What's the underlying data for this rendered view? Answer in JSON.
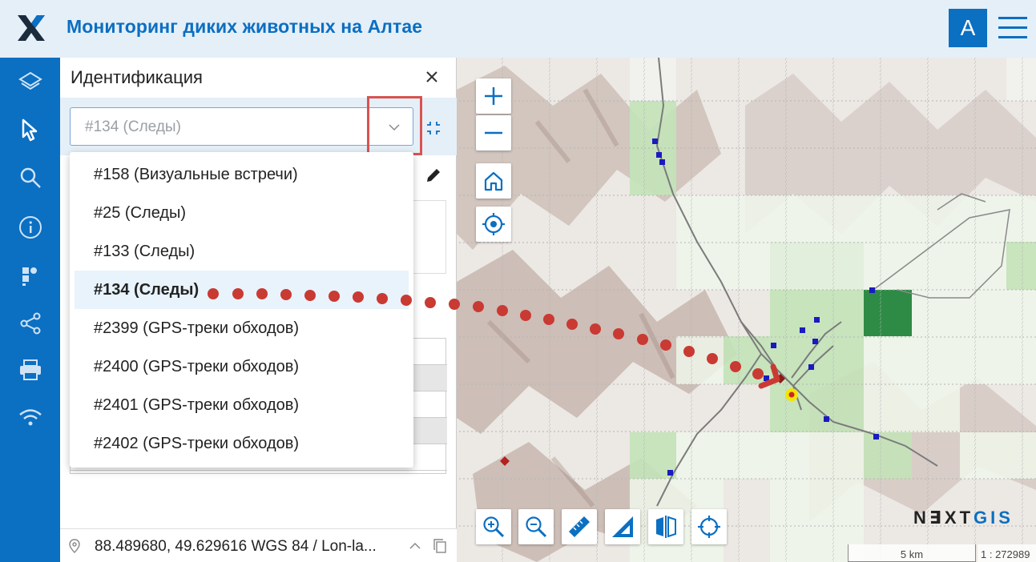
{
  "header": {
    "title": "Мониторинг диких животных на Алтае",
    "avatar_letter": "A"
  },
  "rail": {
    "items": [
      "layers-icon",
      "select-cursor-icon",
      "search-icon",
      "info-icon",
      "bookmark-icon",
      "share-icon",
      "print-icon",
      "wifi-icon"
    ]
  },
  "panel": {
    "title": "Идентификация",
    "select": {
      "value": "#134 (Следы)"
    },
    "options": [
      "#158 (Визуальные встречи)",
      "#25 (Следы)",
      "#133 (Следы)",
      "#134 (Следы)",
      "#2399 (GPS-треки обходов)",
      "#2400 (GPS-треки обходов)",
      "#2401 (GPS-треки обходов)",
      "#2402 (GPS-треки обходов)"
    ],
    "selected_option": "#134 (Следы)"
  },
  "status": {
    "coordinates": "88.489680, 49.629616 WGS 84 / Lon-la..."
  },
  "map": {
    "brand_a": "N∃XT",
    "brand_b": "GIS",
    "scale_label": "5 km",
    "scale_ratio": "1 : 272989"
  },
  "colors": {
    "accent": "#0b6fc2",
    "header_bg": "#e5eff8",
    "highlight": "#d9534f",
    "cell_light": "#e2f0dc",
    "cell_medium": "#c3e3b8",
    "cell_dark": "#2e8b45"
  }
}
